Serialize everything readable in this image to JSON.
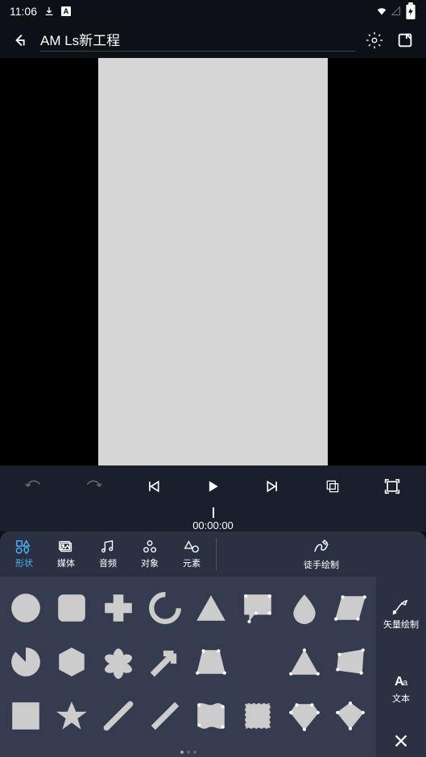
{
  "status": {
    "time": "11:06",
    "download_icon": "download",
    "lang_icon": "A"
  },
  "header": {
    "title": "AM Ls新工程"
  },
  "timeline": {
    "timecode": "00:00:00"
  },
  "tabs": {
    "shape": "形状",
    "media": "媒体",
    "audio": "音频",
    "object": "对象",
    "element": "元素"
  },
  "tools": {
    "freehand": "徒手绘制",
    "vector": "矢量绘制",
    "text": "文本"
  }
}
